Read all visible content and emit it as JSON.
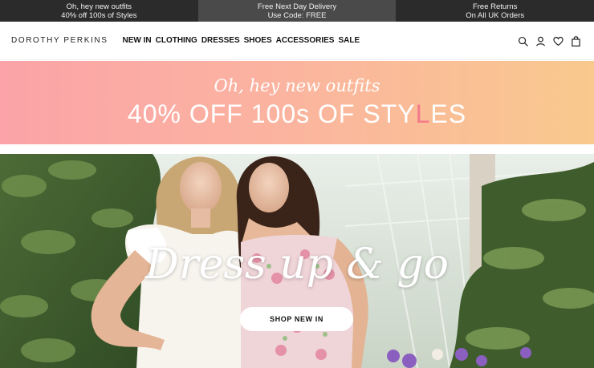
{
  "promo_strip": [
    {
      "line1": "Oh, hey new outfits",
      "line2": "40% off 100s of Styles"
    },
    {
      "line1": "Free Next Day Delivery",
      "line2": "Use Code: FREE"
    },
    {
      "line1": "Free Returns",
      "line2": "On All UK Orders"
    }
  ],
  "header": {
    "logo": "DOROTHY PERKINS",
    "nav": [
      "NEW IN",
      "CLOTHING",
      "DRESSES",
      "SHOES",
      "ACCESSORIES",
      "SALE"
    ],
    "icons": [
      "search-icon",
      "account-icon",
      "wishlist-heart-icon",
      "shopping-bag-icon"
    ]
  },
  "sale_banner": {
    "script_text": "Oh, hey new outfits",
    "headline_before": "40% OFF 100s OF STY",
    "headline_accent": "L",
    "headline_after": "ES",
    "colors": {
      "gradient_start": "#fba3a8",
      "gradient_end": "#f9c98e",
      "accent": "#f37a8a"
    }
  },
  "hero": {
    "title": "Dress up & go",
    "cta_label": "SHOP NEW IN"
  }
}
